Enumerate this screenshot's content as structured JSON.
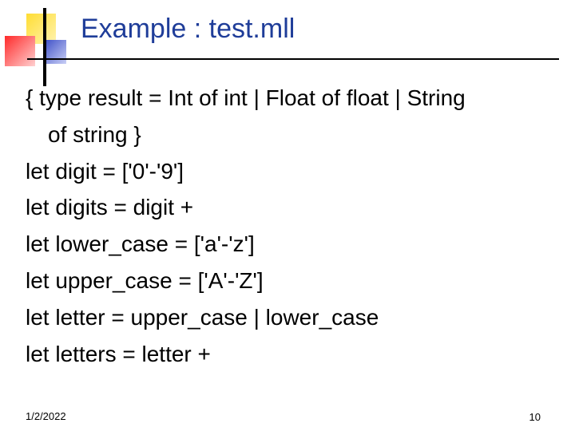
{
  "slide": {
    "title": "Example : test.mll",
    "lines": [
      "{ type result = Int of int | Float of float | String",
      "of string }",
      "let digit = ['0'-'9']",
      "let digits = digit +",
      "let lower_case = ['a'-'z']",
      "let upper_case = ['A'-'Z']",
      "let letter = upper_case | lower_case",
      "let letters = letter +"
    ]
  },
  "footer": {
    "date": "1/2/2022",
    "page_number": "10"
  },
  "colors": {
    "title": "#1f3d99",
    "logo_yellow": "#ffe566",
    "logo_red": "#ff4040",
    "logo_blue": "#5b68d6"
  }
}
